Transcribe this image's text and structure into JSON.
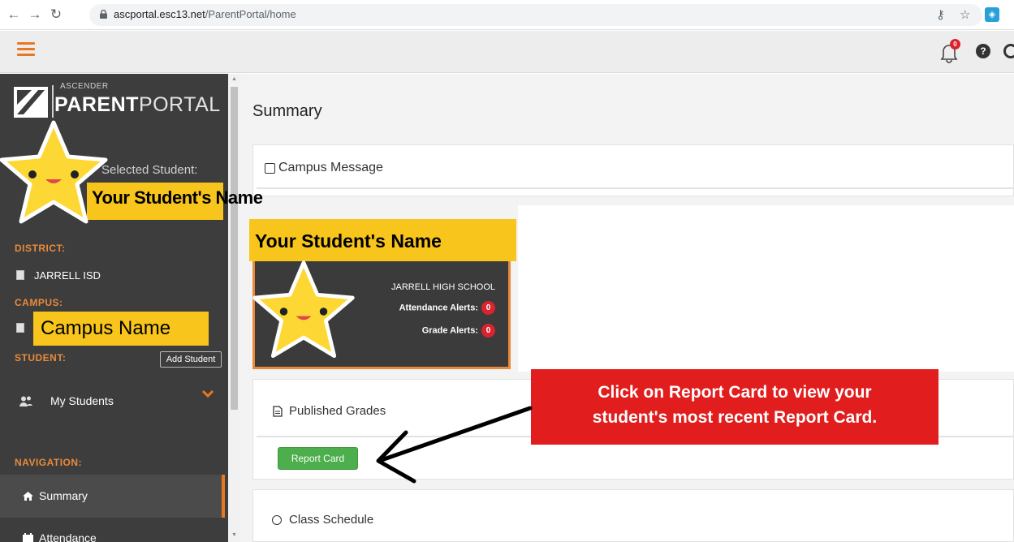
{
  "browser": {
    "url_host": "ascportal.esc13.net",
    "url_path": "/ParentPortal/home"
  },
  "logo": {
    "pre": "ASCENDER",
    "main_bold": "PARENT",
    "main_light": "PORTAL"
  },
  "header": {
    "bell_badge": "0",
    "help_symbol": "?"
  },
  "sidebar": {
    "selected_student_label": "Selected Student:",
    "student_name_overlay": "Your Student's Name",
    "district_label": "DISTRICT:",
    "district_value": "JARRELL ISD",
    "campus_label": "CAMPUS:",
    "campus_overlay": "Campus Name",
    "student_label": "STUDENT:",
    "add_student": "Add Student",
    "my_students": "My Students",
    "navigation_label": "NAVIGATION:",
    "nav_summary": "Summary",
    "nav_attendance": "Attendance"
  },
  "main": {
    "title": "Summary",
    "campus_message": "Campus Message",
    "student_name_overlay": "Your Student's Name",
    "school": "JARRELL HIGH SCHOOL",
    "attendance_alerts_label": "Attendance Alerts:",
    "attendance_alerts_count": "0",
    "grade_alerts_label": "Grade Alerts:",
    "grade_alerts_count": "0",
    "published_grades": "Published Grades",
    "report_card": "Report Card",
    "class_schedule": "Class Schedule"
  },
  "annotation": {
    "callout_line1": "Click on Report Card to view your",
    "callout_line2": "student's most recent Report Card."
  },
  "colors": {
    "accent_orange": "#e87722",
    "sidebar_bg": "#3d3d3d",
    "highlight_yellow": "#f7c51b",
    "callout_red": "#e11d1d",
    "button_green": "#4cae4c",
    "badge_red": "#d9232e"
  }
}
